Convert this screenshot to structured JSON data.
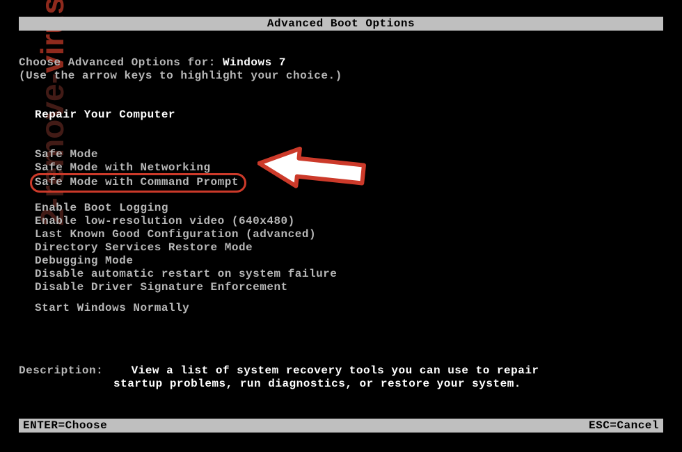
{
  "title": "Advanced Boot Options",
  "prompt_prefix": "Choose Advanced Options for: ",
  "os_name": "Windows 7",
  "hint": "(Use the arrow keys to highlight your choice.)",
  "repair": "Repair Your Computer",
  "options": {
    "safe_mode": "Safe Mode",
    "safe_mode_net": "Safe Mode with Networking",
    "safe_mode_cmd": "Safe Mode with Command Prompt",
    "boot_logging": "Enable Boot Logging",
    "low_res": "Enable low-resolution video (640x480)",
    "last_known": "Last Known Good Configuration (advanced)",
    "ds_restore": "Directory Services Restore Mode",
    "debug": "Debugging Mode",
    "no_restart": "Disable automatic restart on system failure",
    "no_sig": "Disable Driver Signature Enforcement",
    "start_normal": "Start Windows Normally"
  },
  "description_label": "Description:",
  "description_line1": "View a list of system recovery tools you can use to repair",
  "description_line2": "startup problems, run diagnostics, or restore your system.",
  "footer_left": "ENTER=Choose",
  "footer_right": "ESC=Cancel",
  "watermark_a": "2-remove-",
  "watermark_b": "virus.com"
}
